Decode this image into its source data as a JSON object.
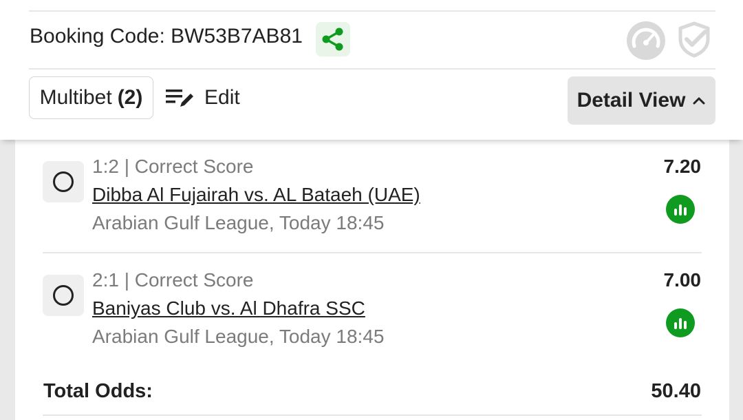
{
  "header": {
    "booking_label": "Booking Code:",
    "booking_code": "BW53B7AB81",
    "share_icon": "share-icon",
    "multibet_label": "Multibet",
    "multibet_count": "(2)",
    "edit_label": "Edit",
    "detail_view_label": "Detail View"
  },
  "bets": [
    {
      "market": "1:2 | Correct Score",
      "match": "Dibba Al Fujairah vs. AL Bataeh (UAE)",
      "league": "Arabian Gulf League, Today 18:45",
      "odds": "7.20"
    },
    {
      "market": "2:1 | Correct Score",
      "match": "Baniyas Club vs. Al Dhafra SSC",
      "league": "Arabian Gulf League, Today 18:45",
      "odds": "7.00"
    }
  ],
  "totals": {
    "label": "Total Odds:",
    "value": "50.40"
  },
  "colors": {
    "accent_green": "#0f9a20",
    "share_bg": "#e8f5e8",
    "disabled_icon": "#d8d8d8"
  }
}
